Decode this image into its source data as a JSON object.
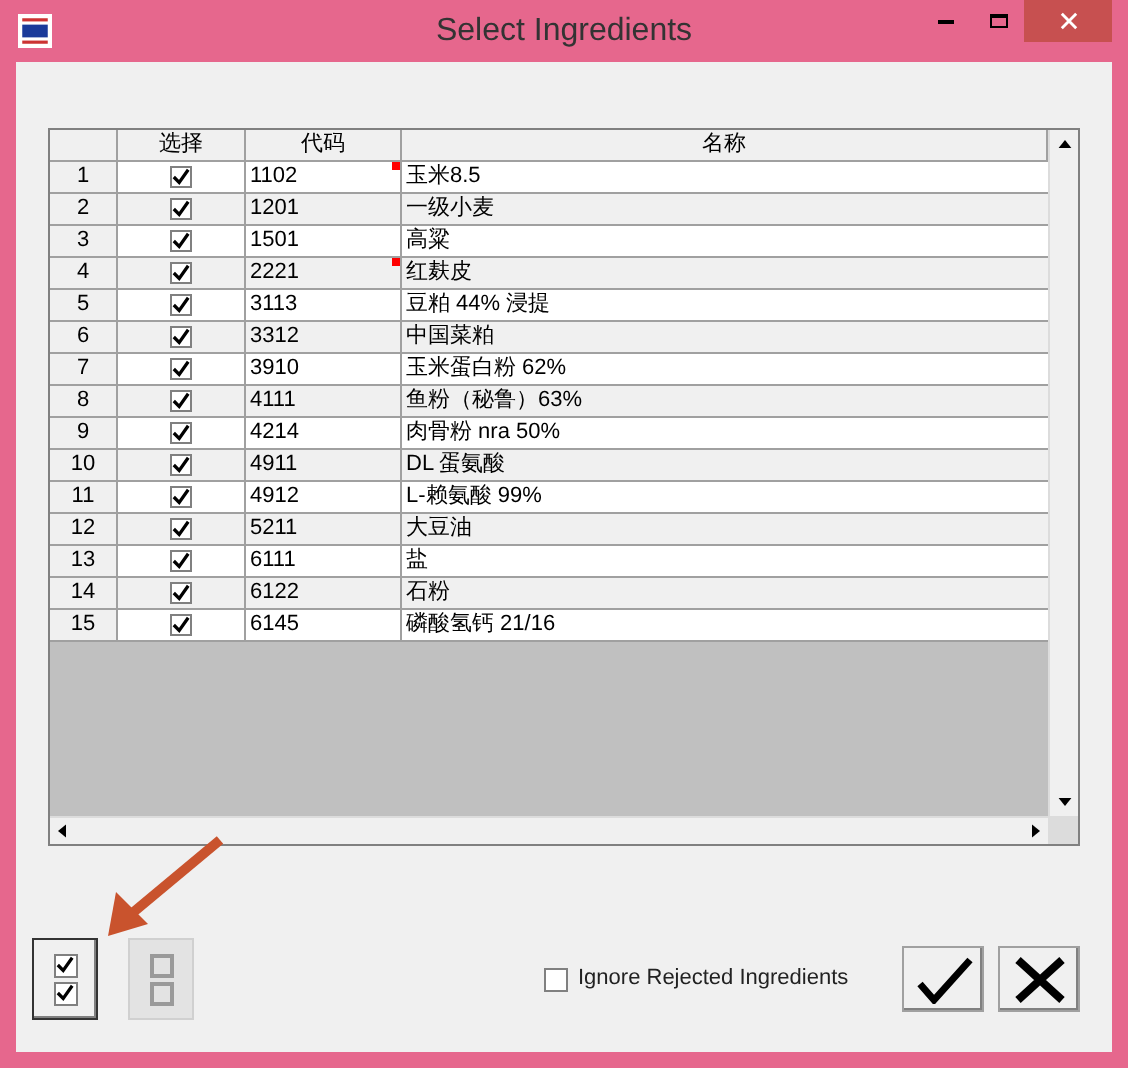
{
  "window": {
    "title": "Select Ingredients"
  },
  "table": {
    "columns": [
      "选择",
      "代码",
      "名称"
    ],
    "rows": [
      {
        "number": "1",
        "checked": true,
        "code": "1102",
        "marked": true,
        "name": "玉米8.5"
      },
      {
        "number": "2",
        "checked": true,
        "code": "1201",
        "marked": false,
        "name": "一级小麦"
      },
      {
        "number": "3",
        "checked": true,
        "code": "1501",
        "marked": false,
        "name": "高粱"
      },
      {
        "number": "4",
        "checked": true,
        "code": "2221",
        "marked": true,
        "name": "红麸皮"
      },
      {
        "number": "5",
        "checked": true,
        "code": "3113",
        "marked": false,
        "name": "豆粕 44% 浸提"
      },
      {
        "number": "6",
        "checked": true,
        "code": "3312",
        "marked": false,
        "name": "中国菜粕"
      },
      {
        "number": "7",
        "checked": true,
        "code": "3910",
        "marked": false,
        "name": "玉米蛋白粉 62%"
      },
      {
        "number": "8",
        "checked": true,
        "code": "4111",
        "marked": false,
        "name": "鱼粉（秘鲁）63%"
      },
      {
        "number": "9",
        "checked": true,
        "code": "4214",
        "marked": false,
        "name": "肉骨粉 nra 50%"
      },
      {
        "number": "10",
        "checked": true,
        "code": "4911",
        "marked": false,
        "name": "DL 蛋氨酸"
      },
      {
        "number": "11",
        "checked": true,
        "code": "4912",
        "marked": false,
        "name": "L-赖氨酸 99%"
      },
      {
        "number": "12",
        "checked": true,
        "code": "5211",
        "marked": false,
        "name": "大豆油"
      },
      {
        "number": "13",
        "checked": true,
        "code": "6111",
        "marked": false,
        "name": "盐"
      },
      {
        "number": "14",
        "checked": true,
        "code": "6122",
        "marked": false,
        "name": "石粉"
      },
      {
        "number": "15",
        "checked": true,
        "code": "6145",
        "marked": false,
        "name": "磷酸氢钙 21/16"
      }
    ]
  },
  "ignore_rejected": {
    "label": "Ignore Rejected Ingredients",
    "checked": false
  }
}
